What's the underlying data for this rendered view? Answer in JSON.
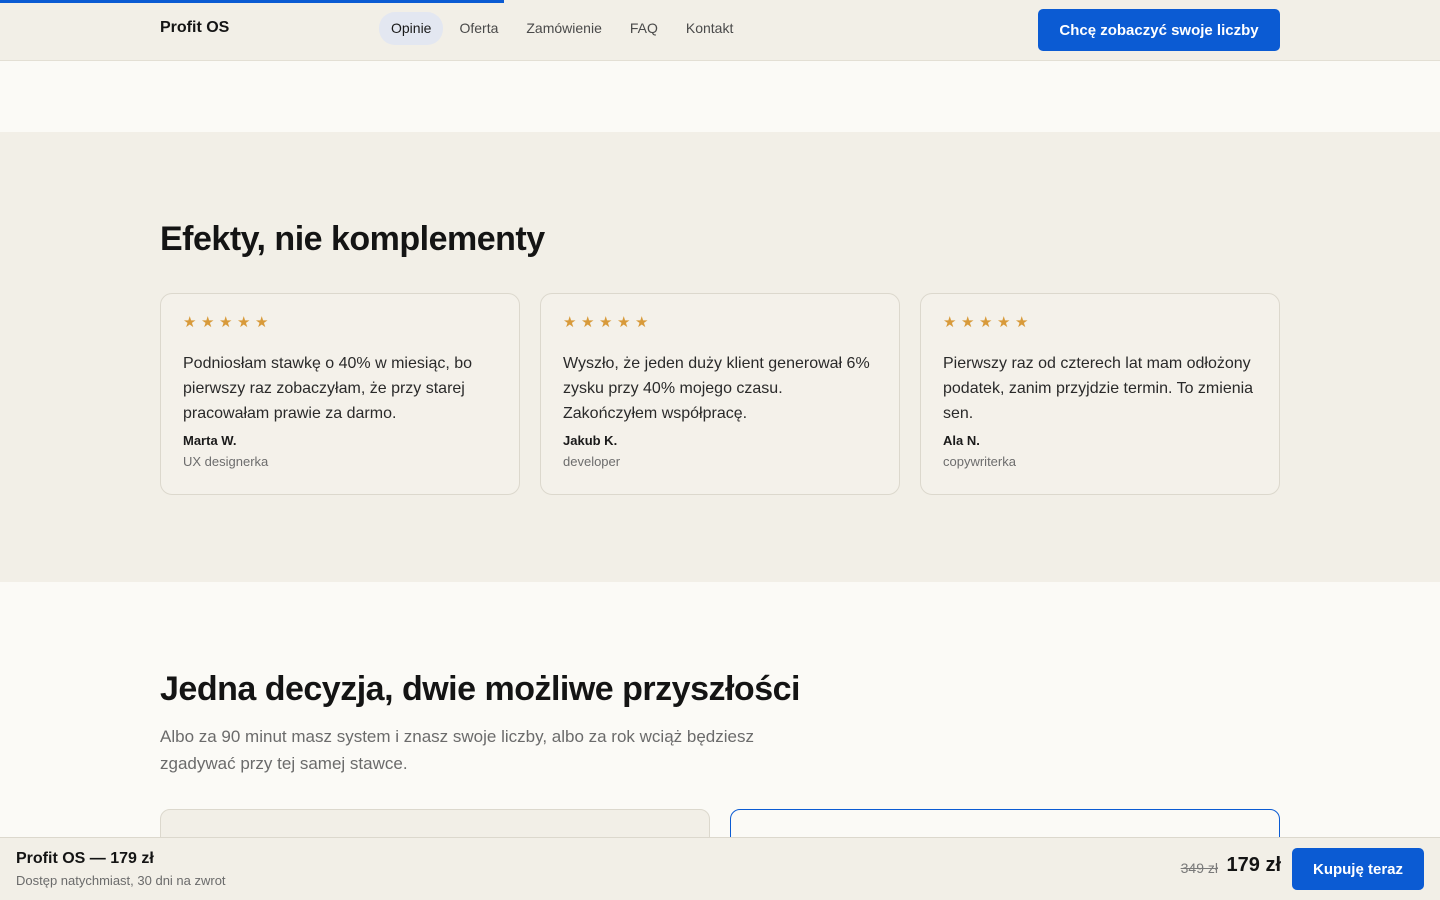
{
  "header": {
    "brand": "Profit OS",
    "nav": [
      "Opinie",
      "Oferta",
      "Zamówienie",
      "FAQ",
      "Kontakt"
    ],
    "active_nav": "Opinie",
    "cta": "Chcę zobaczyć swoje liczby",
    "scroll_progress": 0.35
  },
  "testimonials": {
    "title": "Efekty, nie komplementy",
    "items": [
      {
        "rating": 5,
        "quote": "Podniosłam stawkę o 40% w miesiąc, bo pierwszy raz zobaczyłam, że przy starej pracowałam prawie za darmo.",
        "author": "Marta W.",
        "role": "UX designerka"
      },
      {
        "rating": 5,
        "quote": "Wyszło, że jeden duży klient generował 6% zysku przy 40% mojego czasu. Zakończyłem współpracę.",
        "author": "Jakub K.",
        "role": "developer"
      },
      {
        "rating": 5,
        "quote": "Pierwszy raz od czterech lat mam odłożony podatek, zanim przyjdzie termin. To zmienia sen.",
        "author": "Ala N.",
        "role": "copywriterka"
      }
    ]
  },
  "futures": {
    "title": "Jedna decyzja, dwie możliwe przyszłości",
    "lead": "Albo za 90 minut masz system i znasz swoje liczby, albo za rok wciąż będziesz zgadywać przy tej samej stawce."
  },
  "sticky": {
    "title": "Profit OS — 179 zł",
    "subtitle": "Dostęp natychmiast, 30 dni na zwrot",
    "old_price": "349 zł",
    "new_price": "179 zł",
    "buy": "Kupuję teraz"
  },
  "colors": {
    "accent": "#0b5bd3",
    "star": "#d89a3a",
    "section_bg": "#f2efe7",
    "page_bg": "#fbfaf6"
  },
  "icons": {
    "star": "star-icon"
  }
}
